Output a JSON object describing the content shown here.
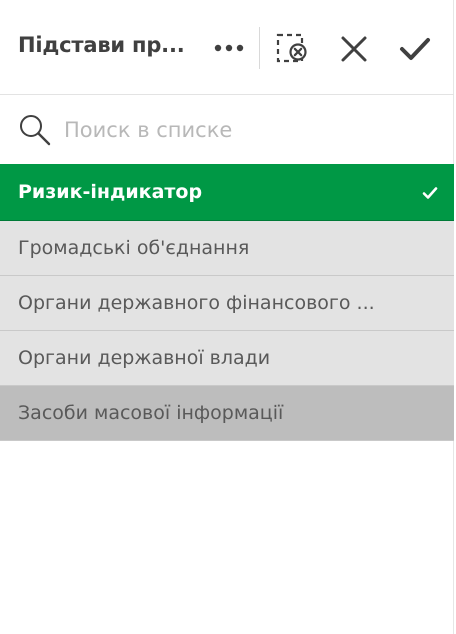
{
  "toolbar": {
    "title": "Підстави пр...",
    "more_icon": "more-horizontal-icon",
    "clear_icon": "clear-selection-icon",
    "cancel_icon": "close-icon",
    "confirm_icon": "checkmark-icon"
  },
  "search": {
    "icon": "search-icon",
    "placeholder": "Поиск в списке"
  },
  "list": {
    "items": [
      {
        "label": "Ризик-індикатор",
        "state": "selected"
      },
      {
        "label": "Громадські об'єднання",
        "state": "alternative"
      },
      {
        "label": "Органи державного фінансового ...",
        "state": "alternative"
      },
      {
        "label": "Органи державної влади",
        "state": "alternative"
      },
      {
        "label": "Засоби масової інформації",
        "state": "excluded"
      }
    ]
  },
  "colors": {
    "selected": "#009845",
    "alternative": "#e3e3e3",
    "excluded": "#bdbdbd"
  }
}
